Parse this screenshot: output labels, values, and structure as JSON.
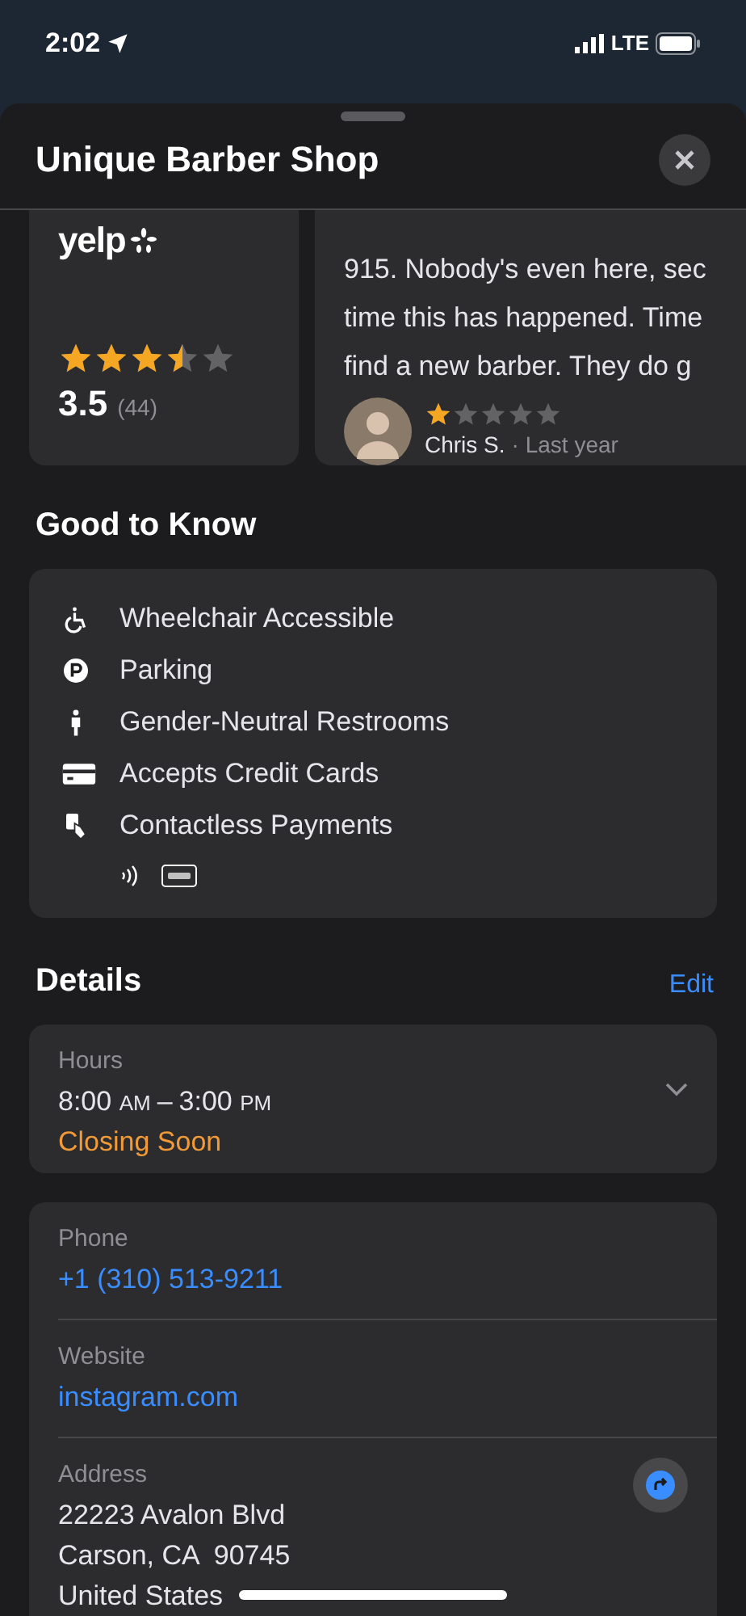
{
  "status_bar": {
    "time": "2:02",
    "network": "LTE"
  },
  "header": {
    "title": "Unique Barber Shop"
  },
  "rating_card": {
    "source": "yelp",
    "stars": 3.5,
    "score": "3.5",
    "count": "(44)"
  },
  "review": {
    "lines": [
      "915. Nobody's even here, sec",
      "time this has happened. Time",
      "find a new barber. They do g"
    ],
    "stars": 1,
    "author": "Chris S.",
    "time": "· Last year"
  },
  "good_to_know": {
    "title": "Good to Know",
    "items": [
      {
        "kind": "wheelchair",
        "label": "Wheelchair Accessible"
      },
      {
        "kind": "parking",
        "label": "Parking"
      },
      {
        "kind": "restroom",
        "label": "Gender-Neutral Restrooms"
      },
      {
        "kind": "card",
        "label": "Accepts Credit Cards"
      },
      {
        "kind": "contactless",
        "label": "Contactless Payments"
      }
    ]
  },
  "details": {
    "title": "Details",
    "edit": "Edit",
    "hours": {
      "label": "Hours",
      "open": "8:00",
      "open_suffix": "AM",
      "dash": "–",
      "close": "3:00",
      "close_suffix": "PM",
      "status": "Closing Soon"
    },
    "phone": {
      "label": "Phone",
      "value": "+1 (310) 513-9211"
    },
    "website": {
      "label": "Website",
      "value": "instagram.com"
    },
    "address": {
      "label": "Address",
      "lines": [
        "22223 Avalon Blvd",
        "Carson, CA  90745",
        "United States"
      ]
    }
  }
}
